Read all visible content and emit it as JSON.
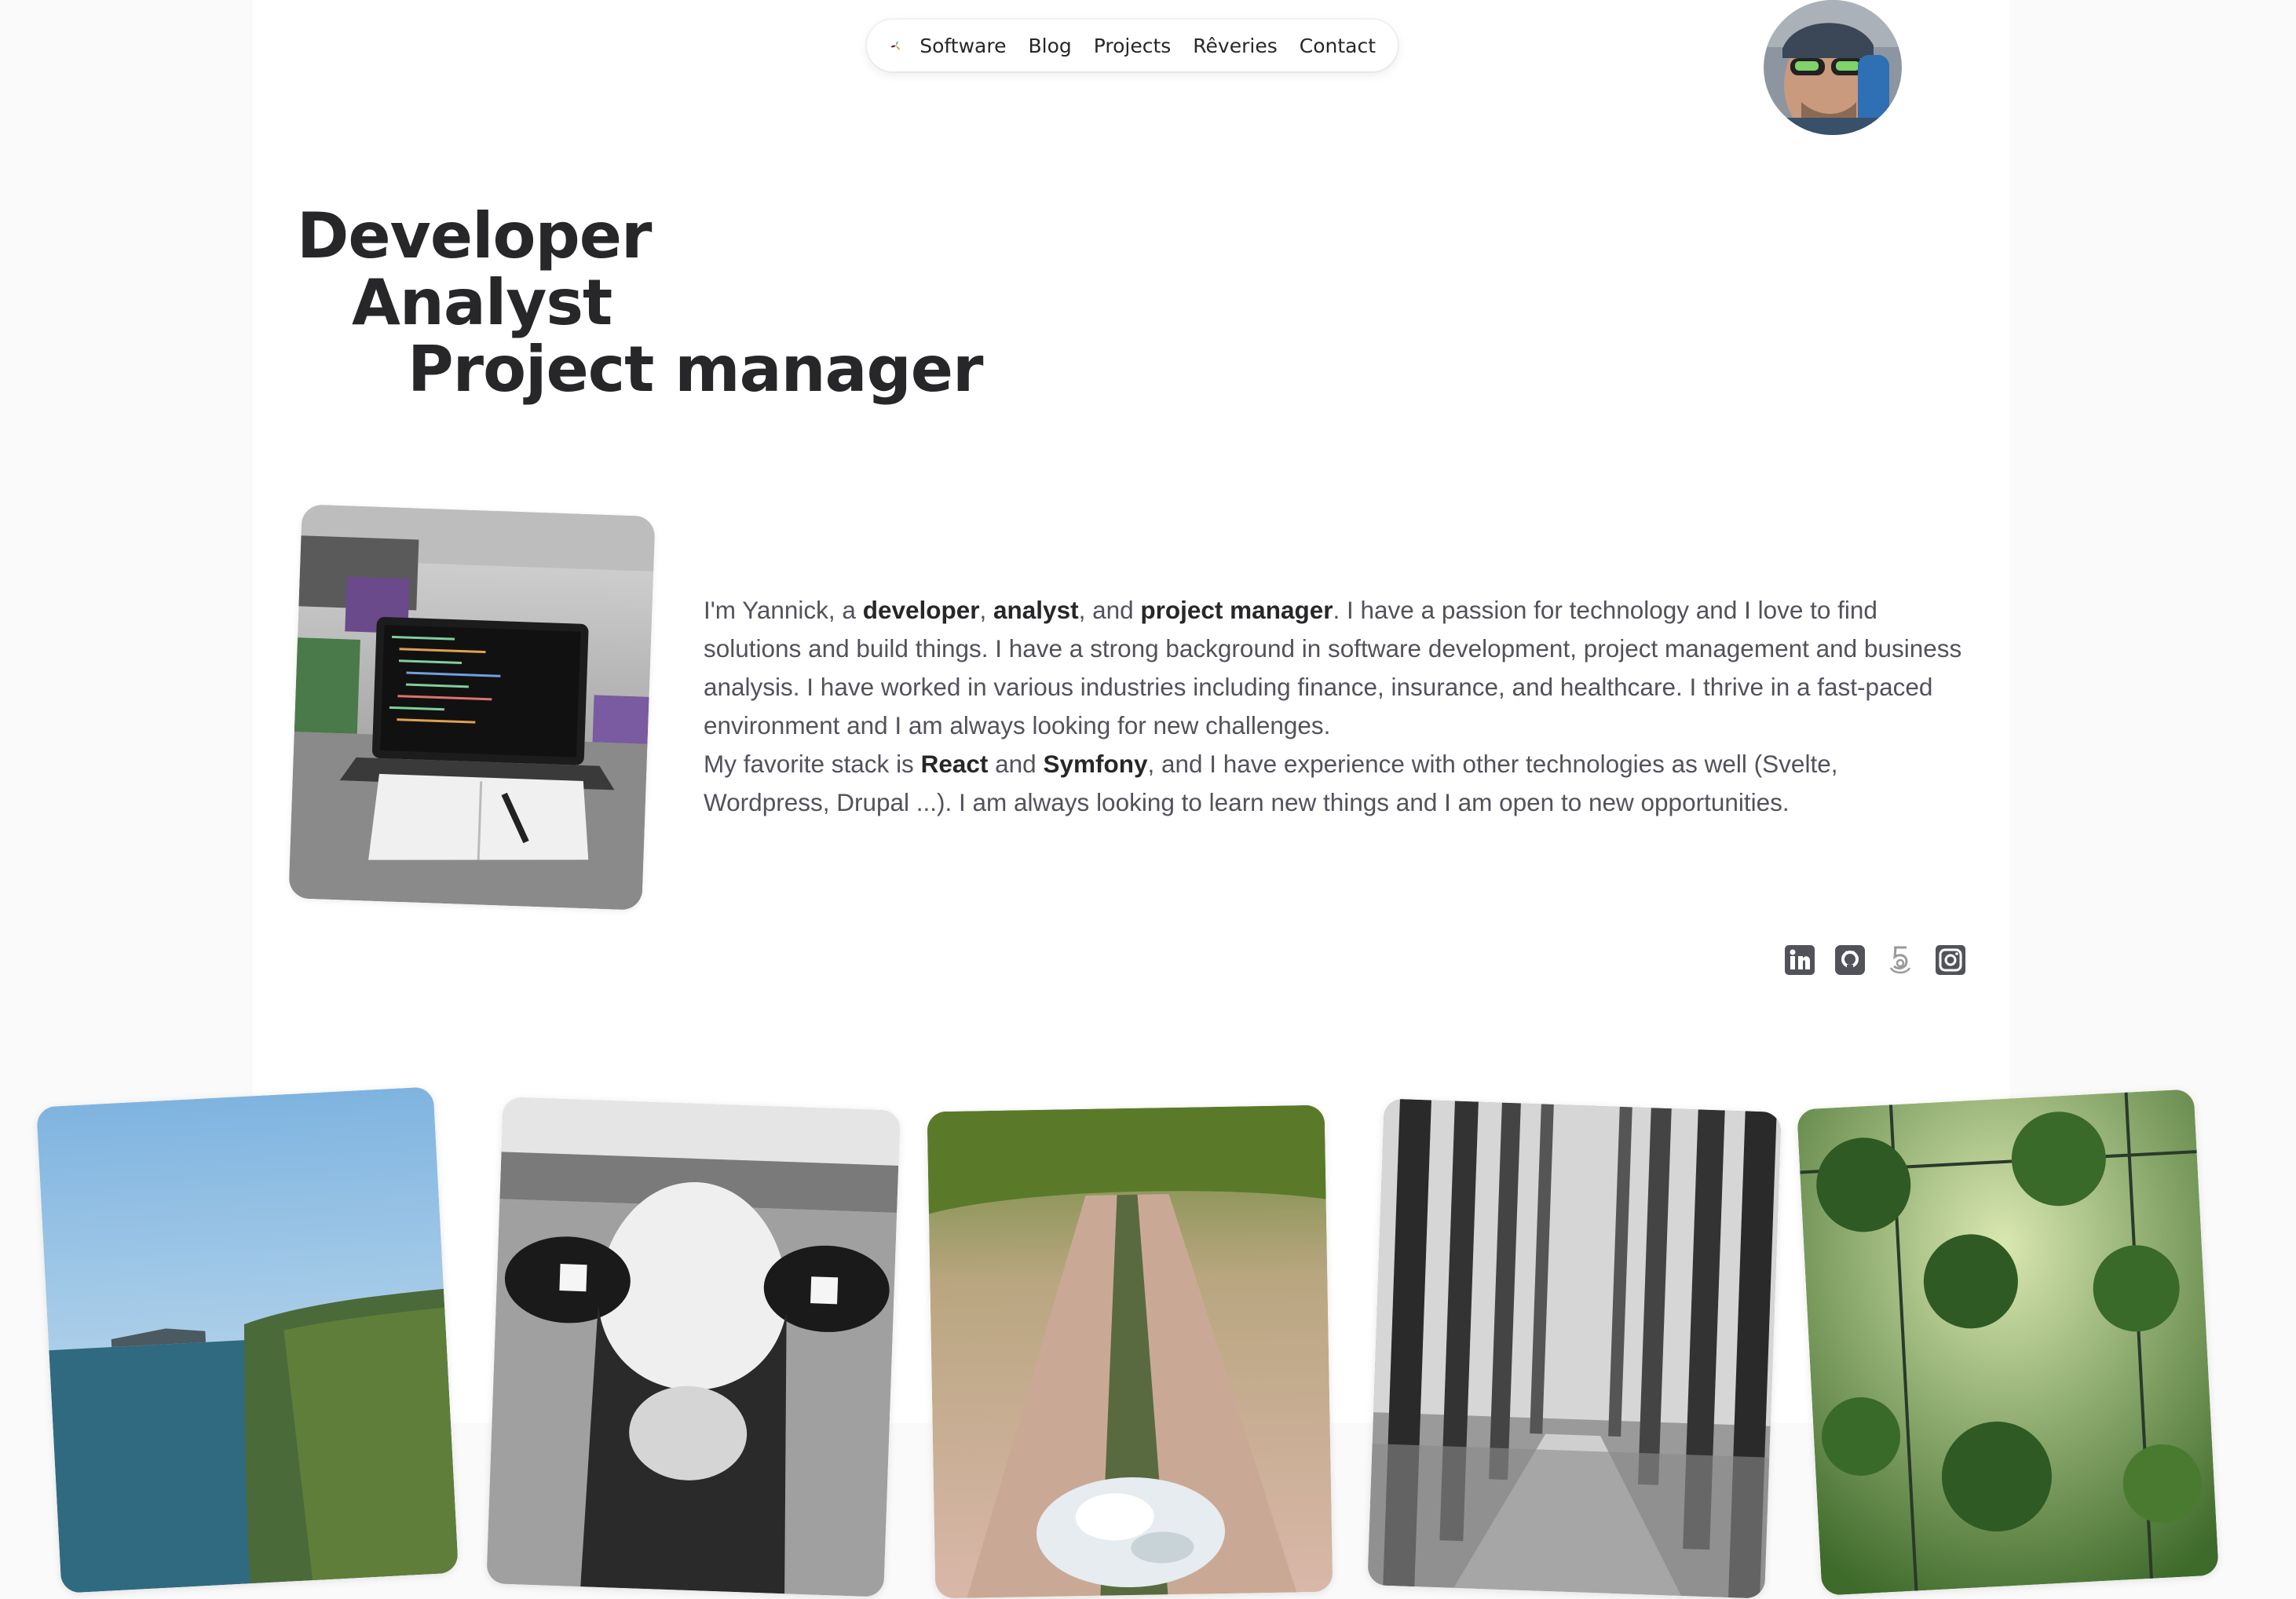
{
  "nav": {
    "logo_icon": "tri-petal-logo-icon",
    "items": [
      "Software",
      "Blog",
      "Projects",
      "Rêveries",
      "Contact"
    ]
  },
  "avatar": {
    "icon": "profile-avatar-photo"
  },
  "hero": {
    "lines": [
      "Developer",
      "Analyst",
      "Project manager"
    ]
  },
  "about": {
    "p1": {
      "s1": "I'm Yannick, a ",
      "b1": "developer",
      "s2": ", ",
      "b2": "analyst",
      "s3": ", and ",
      "b3": "project manager",
      "s4": ". I have a passion for technology and I love to find solutions and build things. I have a strong background in software development, project management and business analysis. I have worked in various industries including finance, insurance, and healthcare. I thrive in a fast-paced environment and I am always looking for new challenges."
    },
    "p2": {
      "s1": "My favorite stack is ",
      "b1": "React",
      "s2": " and ",
      "b2": "Symfony",
      "s3": ", and I have experience with other technologies as well (Svelte, Wordpress, Drupal ...). I am always looking to learn new things and I am open to new opportunities."
    }
  },
  "social": [
    "linkedin-icon",
    "github-icon",
    "500px-icon",
    "instagram-icon"
  ],
  "gallery": [
    "coastal-cliffs-photo",
    "cow-bw-photo",
    "ice-on-path-photo",
    "forest-path-bw-photo",
    "hanging-plants-greenhouse-photo"
  ],
  "colors": {
    "text_primary": "#27272a",
    "text_body": "#52525b",
    "page_bg": "#fafafa",
    "card_bg": "#ffffff",
    "logo_purple": "#6b1d3f",
    "logo_tan": "#d4a35c",
    "logo_teal": "#58a89a"
  }
}
